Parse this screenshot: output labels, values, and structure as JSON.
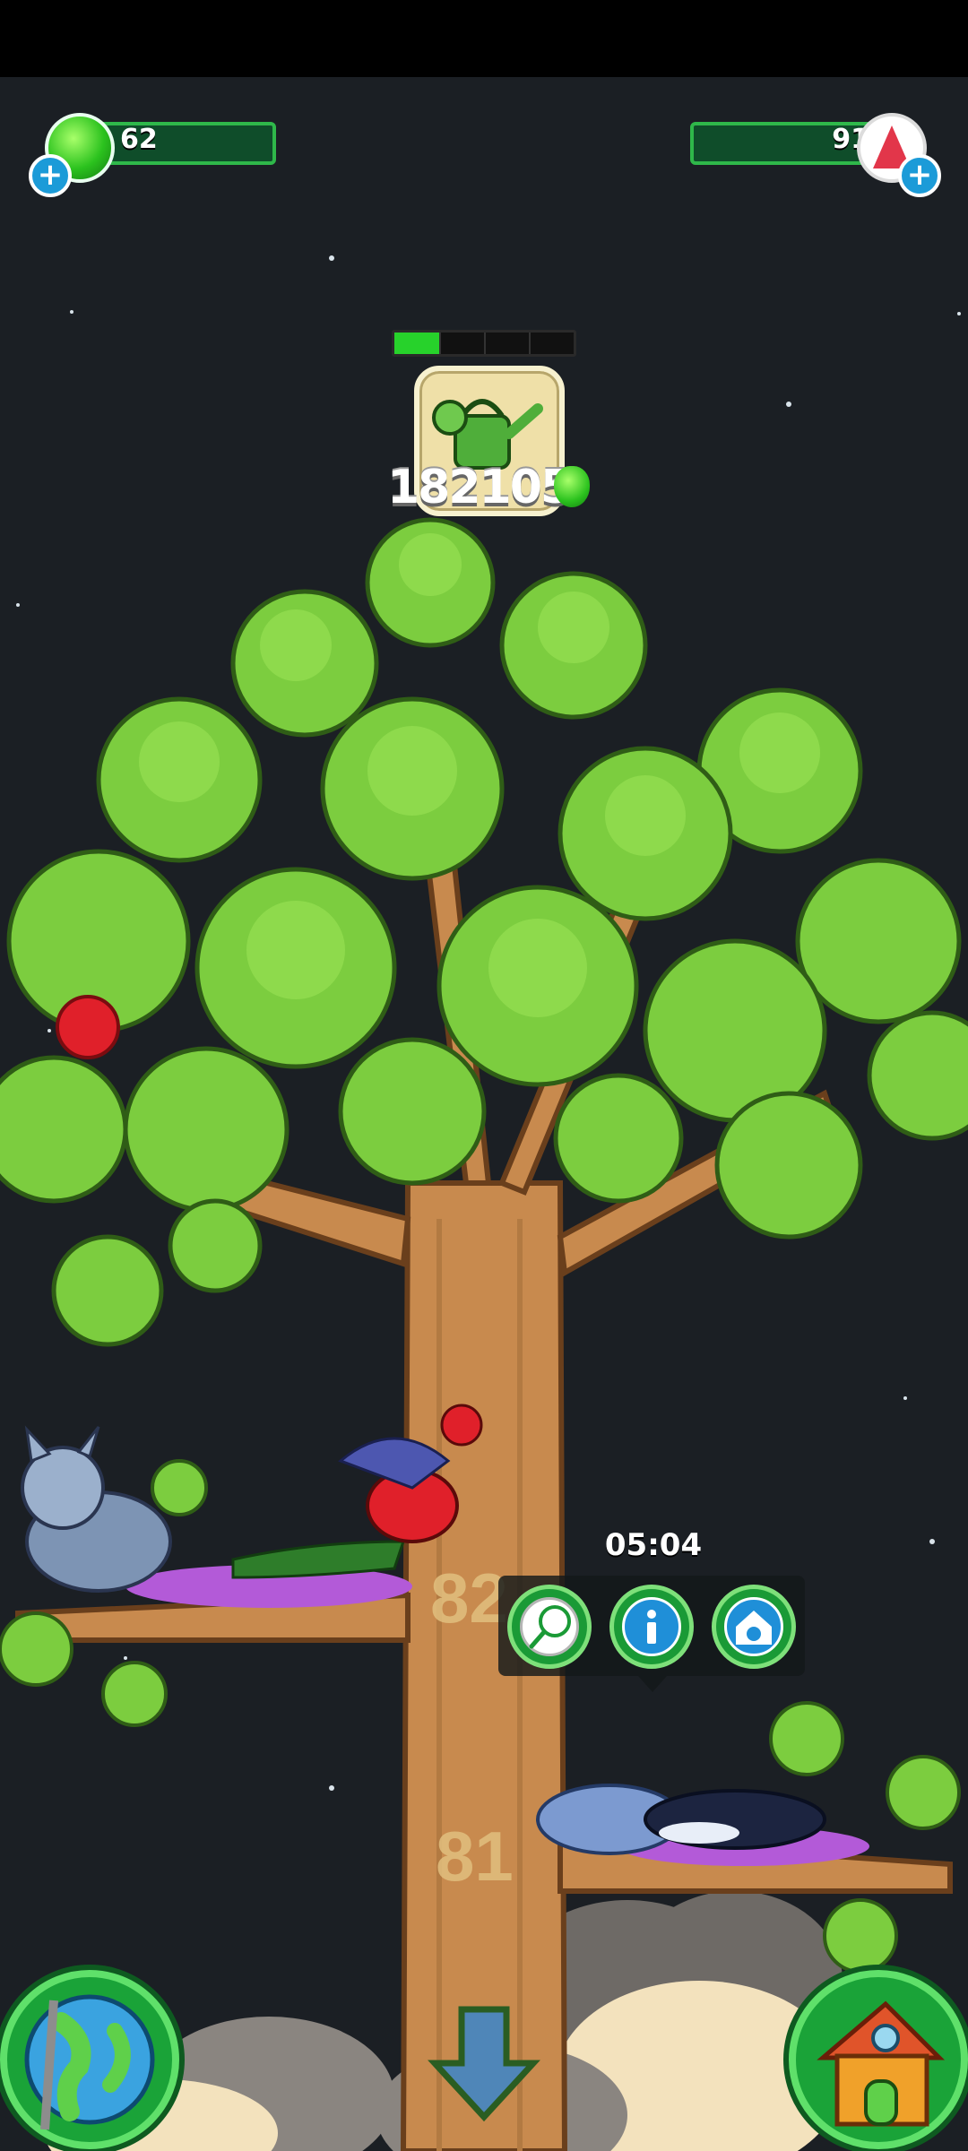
{
  "resources": {
    "gems_green": {
      "value": "62"
    },
    "gems_red": {
      "value": "91"
    }
  },
  "watering": {
    "score": "182105",
    "progress": 0.25
  },
  "branch_levels": [
    "82",
    "81"
  ],
  "selected_nest": {
    "timer": "05:04",
    "actions": [
      "net-icon",
      "info-icon",
      "cat-house-icon"
    ]
  },
  "bottom_nav": {
    "left": "globe-icon",
    "center": "down-arrow-icon",
    "right": "house-icon"
  },
  "colors": {
    "background": "#1b1f24",
    "leaf": "#7ccd3f",
    "trunk": "#c88a4e",
    "accent_green": "#27d22b"
  }
}
